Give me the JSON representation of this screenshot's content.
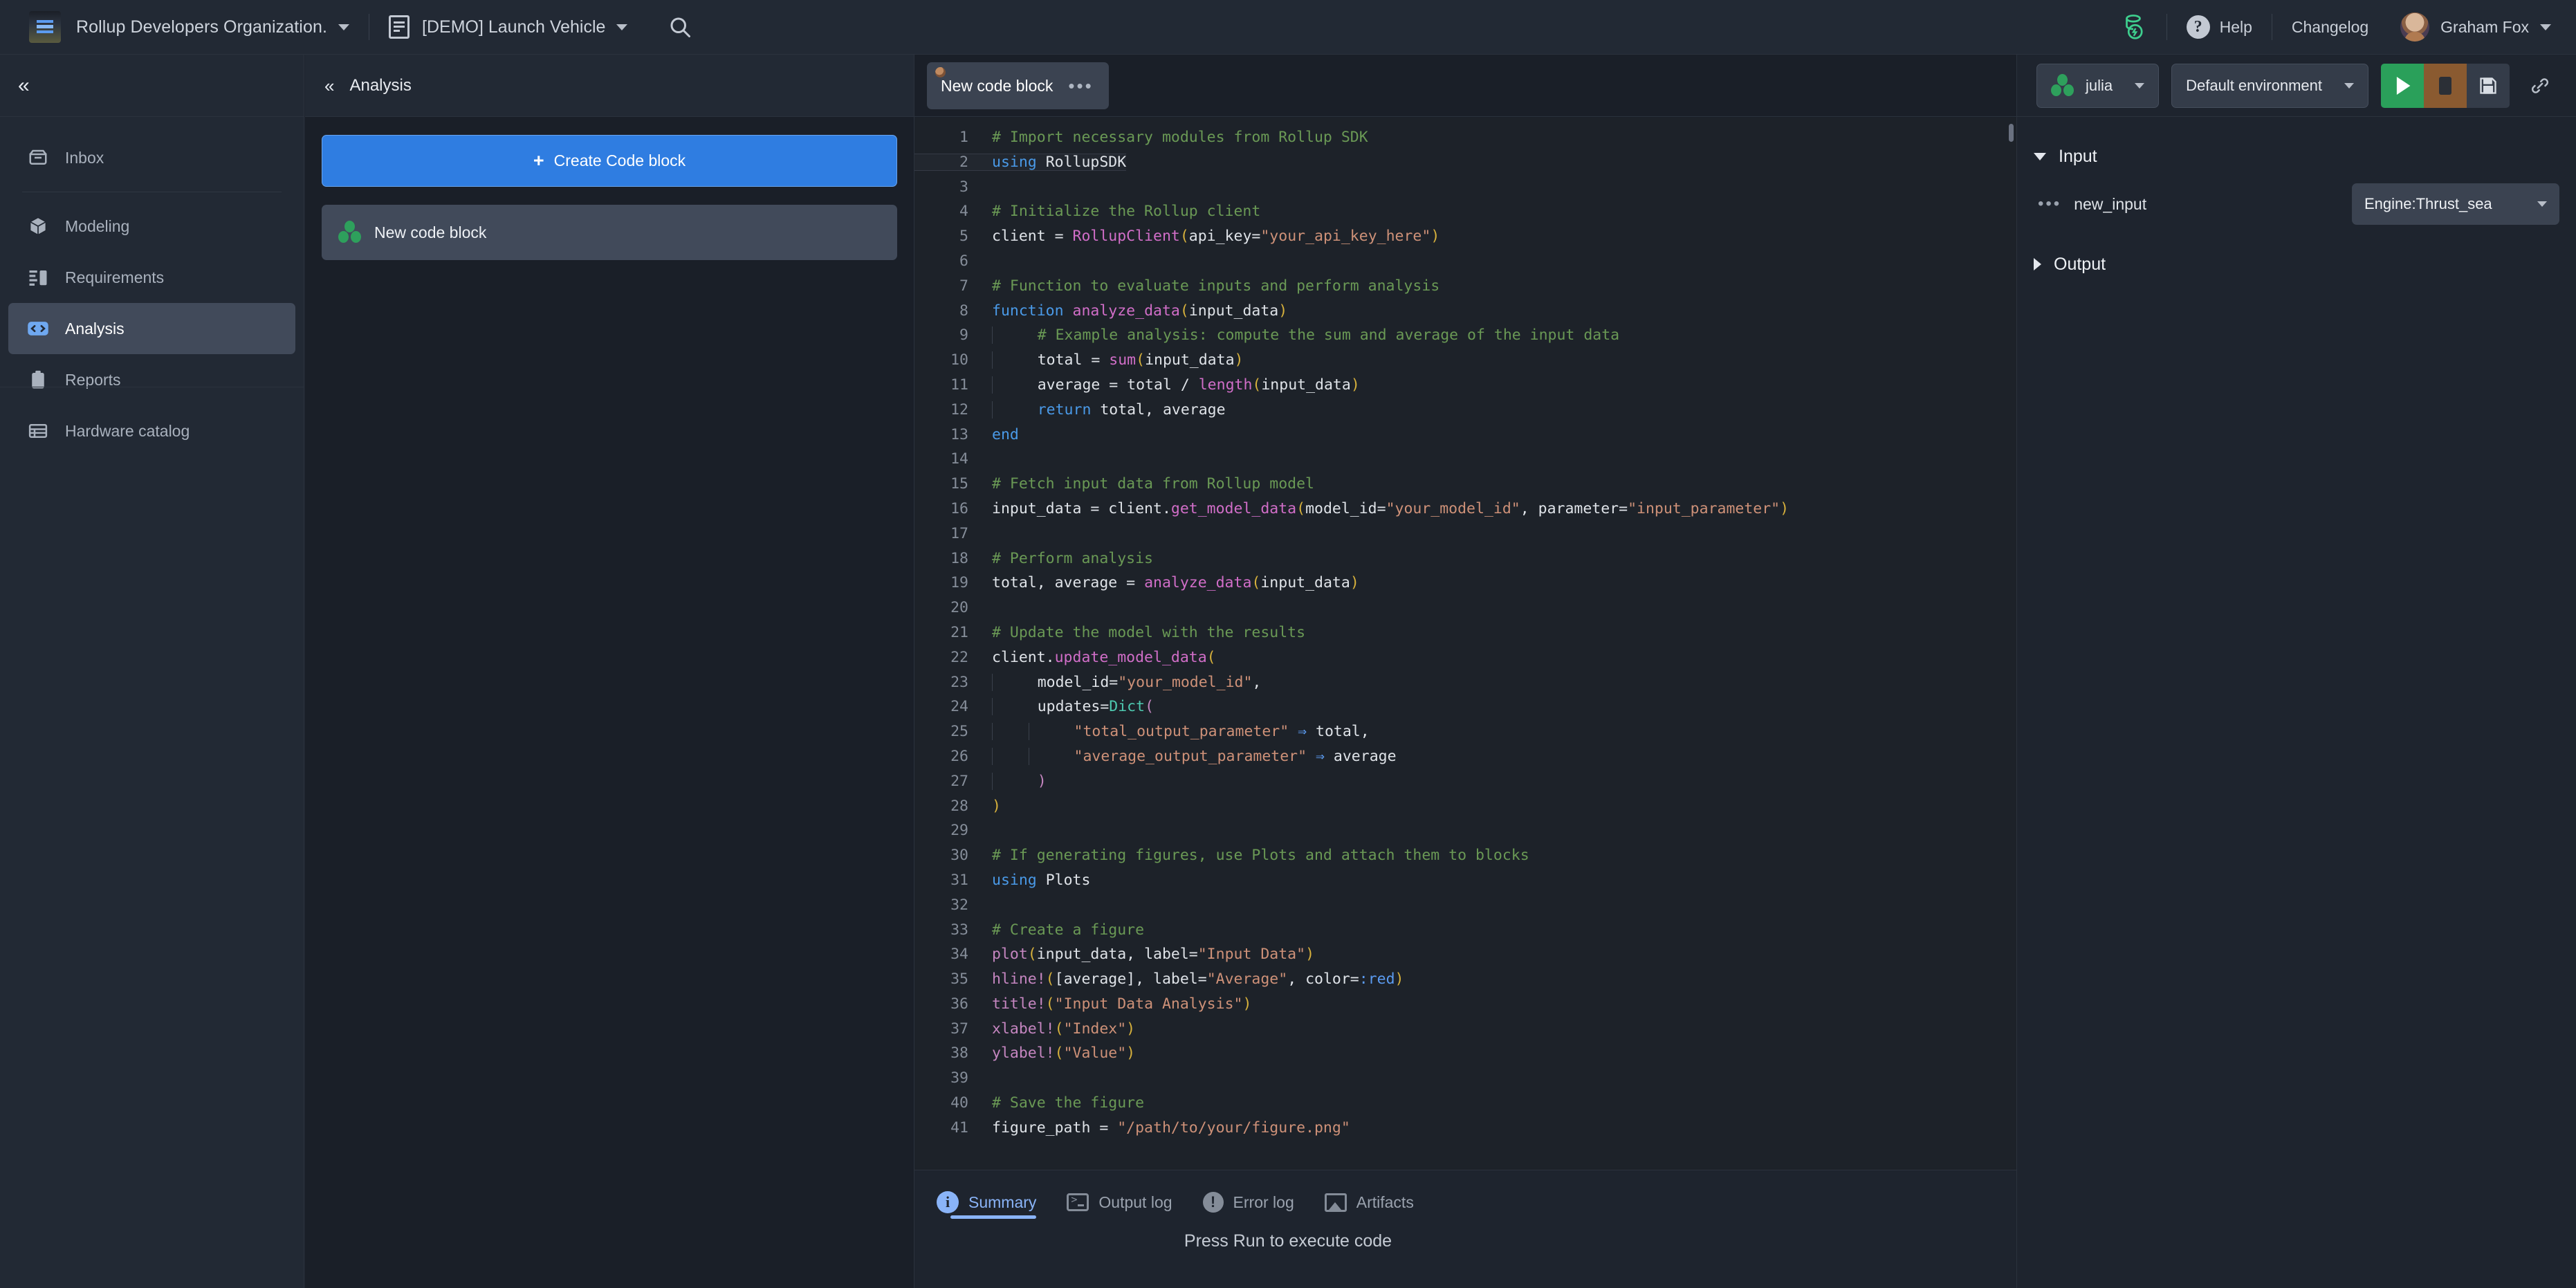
{
  "topbar": {
    "org_name": "Rollup Developers Organization.",
    "doc_name": "[DEMO] Launch Vehicle",
    "help_label": "Help",
    "changelog_label": "Changelog",
    "user_name": "Graham Fox",
    "search_icon": "search-icon",
    "org_chevron": "chevron-down-icon",
    "doc_chevron": "chevron-down-icon",
    "user_chevron": "chevron-down-icon",
    "status_icon": "rollup-status-icon"
  },
  "sidebar": {
    "collapse_icon": "double-chevron-left-icon",
    "items": [
      {
        "label": "Inbox",
        "icon": "inbox-icon",
        "active": false
      },
      {
        "label": "Modeling",
        "icon": "cube-icon",
        "active": false
      },
      {
        "label": "Requirements",
        "icon": "requirements-icon",
        "active": false
      },
      {
        "label": "Analysis",
        "icon": "code-brackets-icon",
        "active": true
      },
      {
        "label": "Reports",
        "icon": "clipboard-icon",
        "active": false
      },
      {
        "label": "Hardware catalog",
        "icon": "catalog-icon",
        "active": false
      }
    ]
  },
  "analysis_panel": {
    "collapse_icon": "double-chevron-left-icon",
    "title": "Analysis",
    "create_button": "Create Code block",
    "create_plus": "+",
    "blocks": [
      {
        "label": "New code block",
        "icon": "julia-logo-icon",
        "selected": true
      }
    ]
  },
  "editor": {
    "tab_name": "New code block",
    "tab_menu": "•••",
    "language": "julia",
    "language_chevron": "chevron-down-icon",
    "environment": "Default environment",
    "environment_chevron": "chevron-down-icon",
    "run_icon": "play-icon",
    "stop_icon": "stop-icon",
    "save_icon": "floppy-disk-save-icon",
    "link_icon": "link-chain-icon",
    "lines": [
      {
        "n": 1,
        "t": "# Import necessary modules from Rollup SDK"
      },
      {
        "n": 2,
        "t": "using RollupSDK"
      },
      {
        "n": 3,
        "t": ""
      },
      {
        "n": 4,
        "t": "# Initialize the Rollup client"
      },
      {
        "n": 5,
        "t": "client = RollupClient(api_key=\"your_api_key_here\")"
      },
      {
        "n": 6,
        "t": ""
      },
      {
        "n": 7,
        "t": "# Function to evaluate inputs and perform analysis"
      },
      {
        "n": 8,
        "t": "function analyze_data(input_data)"
      },
      {
        "n": 9,
        "t": "    # Example analysis: compute the sum and average of the input data"
      },
      {
        "n": 10,
        "t": "    total = sum(input_data)"
      },
      {
        "n": 11,
        "t": "    average = total / length(input_data)"
      },
      {
        "n": 12,
        "t": "    return total, average"
      },
      {
        "n": 13,
        "t": "end"
      },
      {
        "n": 14,
        "t": ""
      },
      {
        "n": 15,
        "t": "# Fetch input data from Rollup model"
      },
      {
        "n": 16,
        "t": "input_data = client.get_model_data(model_id=\"your_model_id\", parameter=\"input_parameter\")"
      },
      {
        "n": 17,
        "t": ""
      },
      {
        "n": 18,
        "t": "# Perform analysis"
      },
      {
        "n": 19,
        "t": "total, average = analyze_data(input_data)"
      },
      {
        "n": 20,
        "t": ""
      },
      {
        "n": 21,
        "t": "# Update the model with the results"
      },
      {
        "n": 22,
        "t": "client.update_model_data("
      },
      {
        "n": 23,
        "t": "    model_id=\"your_model_id\","
      },
      {
        "n": 24,
        "t": "    updates=Dict("
      },
      {
        "n": 25,
        "t": "        \"total_output_parameter\" => total,"
      },
      {
        "n": 26,
        "t": "        \"average_output_parameter\" => average"
      },
      {
        "n": 27,
        "t": "    )"
      },
      {
        "n": 28,
        "t": ")"
      },
      {
        "n": 29,
        "t": ""
      },
      {
        "n": 30,
        "t": "# If generating figures, use Plots and attach them to blocks"
      },
      {
        "n": 31,
        "t": "using Plots"
      },
      {
        "n": 32,
        "t": ""
      },
      {
        "n": 33,
        "t": "# Create a figure"
      },
      {
        "n": 34,
        "t": "plot(input_data, label=\"Input Data\")"
      },
      {
        "n": 35,
        "t": "hline!([average], label=\"Average\", color=:red)"
      },
      {
        "n": 36,
        "t": "title!(\"Input Data Analysis\")"
      },
      {
        "n": 37,
        "t": "xlabel!(\"Index\")"
      },
      {
        "n": 38,
        "t": "ylabel!(\"Value\")"
      },
      {
        "n": 39,
        "t": ""
      },
      {
        "n": 40,
        "t": "# Save the figure"
      },
      {
        "n": 41,
        "t": "figure_path = \"/path/to/your/figure.png\""
      }
    ]
  },
  "bottom_panel": {
    "tabs": [
      {
        "label": "Summary",
        "icon": "info-icon",
        "active": true
      },
      {
        "label": "Output log",
        "icon": "terminal-icon",
        "active": false
      },
      {
        "label": "Error log",
        "icon": "alert-icon",
        "active": false
      },
      {
        "label": "Artifacts",
        "icon": "image-icon",
        "active": false
      }
    ],
    "empty_message": "Press Run to execute code"
  },
  "right_panel": {
    "input_section": {
      "title": "Input",
      "expanded": true,
      "toggle_icon": "triangle-down-icon",
      "rows": [
        {
          "menu": "•••",
          "name": "new_input",
          "value": "Engine:Thrust_sea",
          "chevron": "chevron-down-icon"
        }
      ]
    },
    "output_section": {
      "title": "Output",
      "expanded": false,
      "toggle_icon": "triangle-right-icon"
    }
  },
  "colors": {
    "accent_blue": "#2f7de1",
    "run_green": "#2aa05a",
    "stop_brown": "#8a5a30",
    "tab_blue": "#8ab4f8",
    "bg_dark": "#1a1f28",
    "panel": "#222934"
  }
}
